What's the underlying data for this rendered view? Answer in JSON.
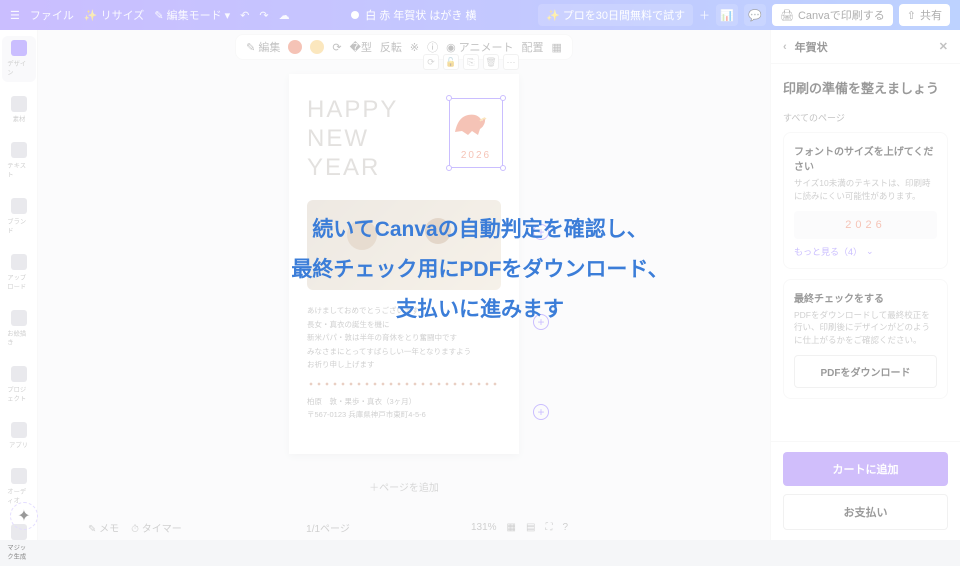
{
  "topbar": {
    "file": "ファイル",
    "resize": "リサイズ",
    "edit_mode": "編集モード",
    "doc_title": "白 赤 年賀状 はがき 横",
    "try_pro": "プロを30日間無料で試す",
    "print": "Canvaで印刷する",
    "share": "共有"
  },
  "sidebar": {
    "items": [
      {
        "label": "デザイン"
      },
      {
        "label": "素材"
      },
      {
        "label": "テキスト"
      },
      {
        "label": "ブランド"
      },
      {
        "label": "アップロード"
      },
      {
        "label": "お絵描き"
      },
      {
        "label": "プロジェクト"
      },
      {
        "label": "アプリ"
      },
      {
        "label": "オーディオ"
      },
      {
        "label": "マジック生成"
      }
    ]
  },
  "toolbar": {
    "edit": "編集",
    "flip": "反転",
    "animate": "アニメート",
    "position": "配置",
    "colors": [
      "#e76a4a",
      "#f5c45e"
    ]
  },
  "canvas": {
    "headline1": "HAPPY",
    "headline2": "NEW",
    "headline3": "YEAR",
    "year": "2026",
    "body1": "あけましておめでとうございます",
    "body2": "長女・真衣の誕生を機に",
    "body3": "新米パパ・敦は半年の育休をとり奮闘中です",
    "body4": "みなさまにとってすばらしい一年となりますよう",
    "body5": "お祈り申し上げます",
    "name": "柏原　敦・果歩・真衣（3ヶ月）",
    "address": "〒567-0123 兵庫県神戸市東町4-5-6",
    "add_page": "＋ページを追加"
  },
  "footer": {
    "notes": "メモ",
    "timer": "タイマー",
    "pages": "1/1ページ",
    "zoom": "131%"
  },
  "rpanel": {
    "title": "年賀状",
    "heading": "印刷の準備を整えましょう",
    "all_pages": "すべてのページ",
    "font_title": "フォントのサイズを上げてください",
    "font_desc": "サイズ10未満のテキストは、印刷時に読みにくい可能性があります。",
    "year_preview": "2026",
    "more": "もっと見る（4）",
    "final_title": "最終チェックをする",
    "final_desc": "PDFをダウンロードして最終校正を行い、印刷後にデザインがどのように仕上がるかをご確認ください。",
    "pdf_btn": "PDFをダウンロード",
    "cart": "カートに追加",
    "pay": "お支払い"
  },
  "overlay": {
    "line1": "続いてCanvaの自動判定を確認し、",
    "line2": "最終チェック用にPDFをダウンロード、",
    "line3": "支払いに進みます"
  }
}
